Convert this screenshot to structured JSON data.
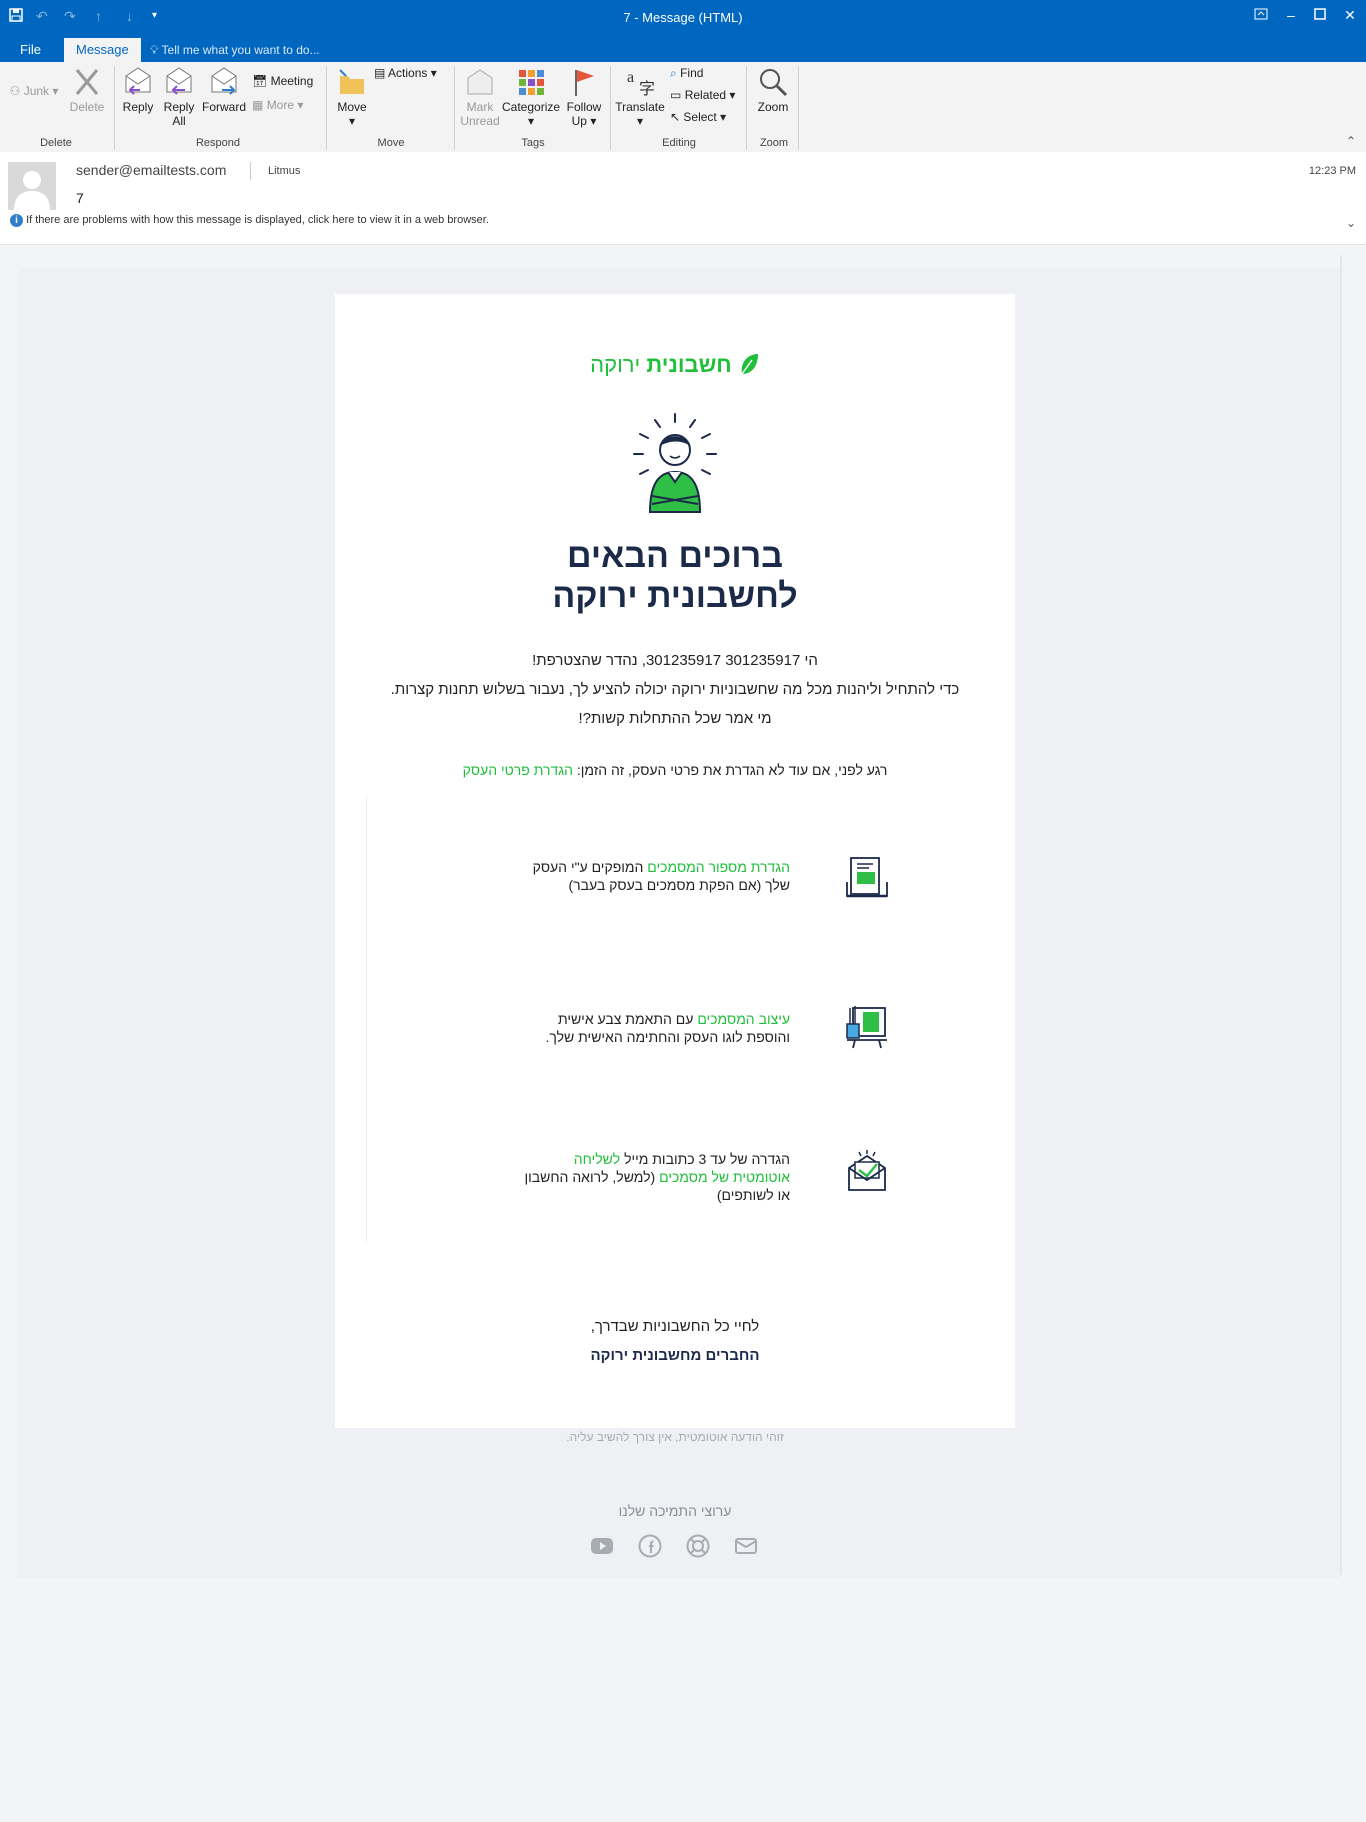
{
  "window": {
    "title": "7 - Message (HTML)"
  },
  "tabs": {
    "file": "File",
    "message": "Message",
    "tell_me": "Tell me what you want to do..."
  },
  "ribbon": {
    "junk": "Junk",
    "delete": "Delete",
    "reply": "Reply",
    "reply_all_1": "Reply",
    "reply_all_2": "All",
    "forward": "Forward",
    "meeting": "Meeting",
    "more": "More",
    "move": "Move",
    "actions": "Actions",
    "mark_unread_1": "Mark",
    "mark_unread_2": "Unread",
    "categorize": "Categorize",
    "follow_up_1": "Follow",
    "follow_up_2": "Up",
    "translate": "Translate",
    "find": "Find",
    "related": "Related",
    "select": "Select",
    "zoom": "Zoom",
    "groups": {
      "delete": "Delete",
      "respond": "Respond",
      "move": "Move",
      "tags": "Tags",
      "editing": "Editing",
      "zoom": "Zoom"
    }
  },
  "message_header": {
    "sender": "sender@emailtests.com",
    "recipient": "Litmus",
    "subject": "7",
    "time": "12:23 PM",
    "info_bar": "If there are problems with how this message is displayed, click here to view it in a web browser."
  },
  "email": {
    "logo_bold": "חשבונית",
    "logo_light": "ירוקה",
    "heading_line1": "ברוכים הבאים",
    "heading_line2": "לחשבונית ירוקה",
    "greeting": "הי 301235917 301235917, נהדר שהצטרפת!",
    "intro": "כדי להתחיל וליהנות מכל מה שחשבוניות ירוקה יכולה להציע לך, נעבור בשלוש תחנות קצרות.",
    "tagline": "מי אמר שכל ההתחלות קשות?!",
    "prompt_text": "רגע לפני, אם עוד לא הגדרת את פרטי העסק, זה הזמן:",
    "prompt_link": "הגדרת פרטי העסק",
    "step1_green": "הגדרת מספור המסמכים",
    "step1_rest": "המופקים ע\"י העסק",
    "step1_line2": "שלך (אם הפקת מסמכים בעסק בעבר)",
    "step2_green": "עיצוב המסמכים",
    "step2_rest": "עם התאמת צבע אישית",
    "step2_line2": "והוספת לוגו העסק והחתימה האישית שלך.",
    "step3_rest": "הגדרה של עד 3 כתובות מייל",
    "step3_green1": "לשליחה",
    "step3_green2": "אוטומטית של מסמכים",
    "step3_rest2": "(למשל, לרואה החשבון",
    "step3_line3": "או לשותפים)",
    "signoff": "לחיי כל החשבוניות שבדרך,",
    "signature": "החברים מחשבונית ירוקה",
    "auto_notice": "זוהי הודעה אוטומטית, אין צורך להשיב עליה.",
    "support_title": "ערוצי התמיכה שלנו"
  },
  "colors": {
    "titlebar": "#0067c0",
    "brand_green": "#1fbf3a",
    "navy": "#1c2a4a"
  }
}
